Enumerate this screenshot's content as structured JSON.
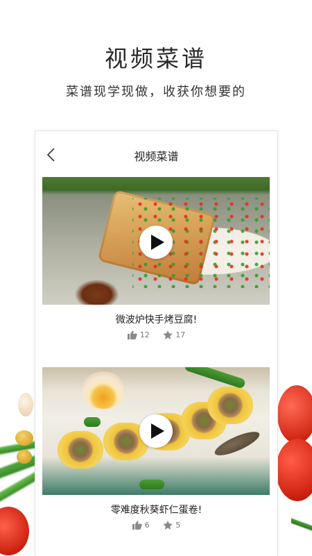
{
  "hero": {
    "title": "视频菜谱",
    "subtitle": "菜谱现学现做，收获你想要的"
  },
  "nav": {
    "title": "视频菜谱",
    "back_icon": "chevron-left-icon"
  },
  "recipes": [
    {
      "title": "微波炉快手烤豆腐!",
      "likes": "12",
      "favorites": "17"
    },
    {
      "title": "零难度秋葵虾仁蛋卷!",
      "likes": "6",
      "favorites": "5"
    }
  ],
  "icons": {
    "play": "play-icon",
    "like": "thumbs-up-icon",
    "favorite": "star-icon"
  },
  "colors": {
    "icon_gray": "#8a8a8a",
    "play_triangle": "#111111",
    "card_border": "#e3e3e3"
  }
}
